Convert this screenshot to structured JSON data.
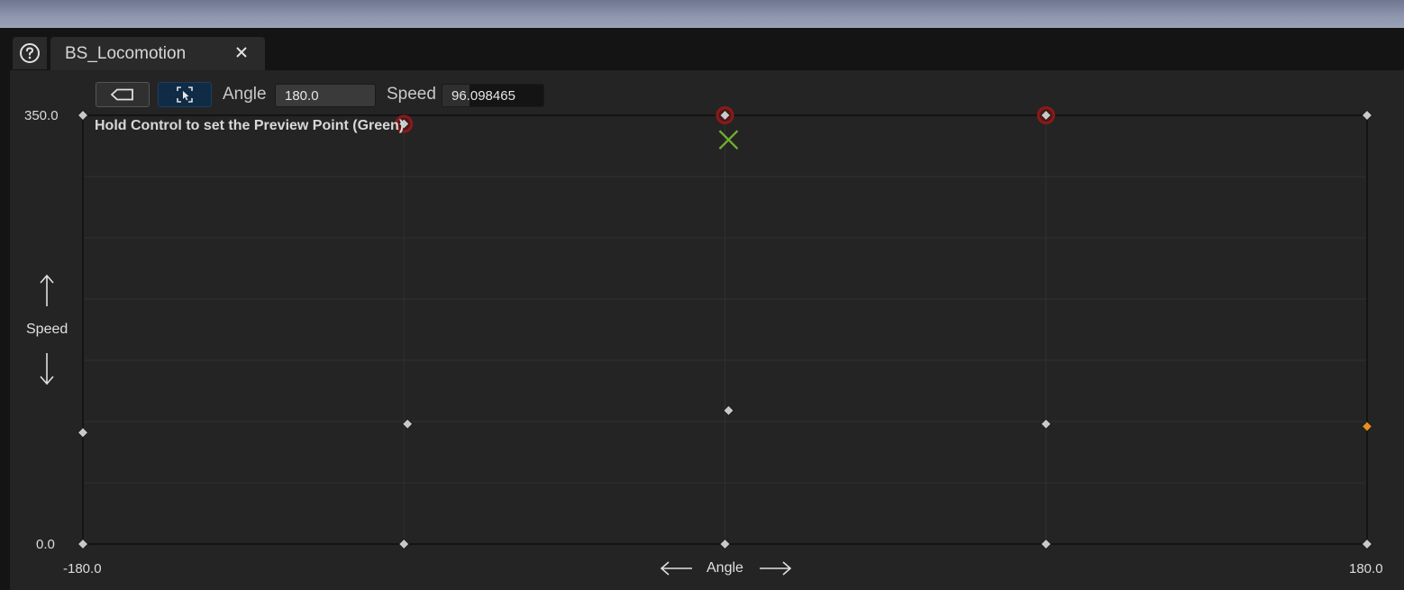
{
  "tab": {
    "title": "BS_Locomotion"
  },
  "toolbar": {
    "angle_label": "Angle",
    "angle_value": "180.0",
    "speed_label": "Speed",
    "speed_value": "96.098465",
    "speed_fill_fraction": 0.27
  },
  "hint": "Hold Control to set the Preview Point (Green)",
  "axes": {
    "y_label": "Speed",
    "y_max_label": "350.0",
    "y_min_label": "0.0",
    "x_label": "Angle",
    "x_min_label": "-180.0",
    "x_max_label": "180.0"
  },
  "chart_data": {
    "type": "scatter",
    "xlabel": "Angle",
    "ylabel": "Speed",
    "xlim": [
      -180,
      180
    ],
    "ylim": [
      0,
      350
    ],
    "grid": true,
    "x_divisions": 4,
    "y_divisions": 7,
    "samples": [
      {
        "x": -180,
        "y": 350,
        "state": "normal"
      },
      {
        "x": -90,
        "y": 343,
        "state": "invalid"
      },
      {
        "x": 0,
        "y": 350,
        "state": "invalid"
      },
      {
        "x": 90,
        "y": 350,
        "state": "invalid"
      },
      {
        "x": 180,
        "y": 350,
        "state": "normal"
      },
      {
        "x": -180,
        "y": 91,
        "state": "normal"
      },
      {
        "x": -89,
        "y": 98,
        "state": "normal"
      },
      {
        "x": 1,
        "y": 109,
        "state": "normal"
      },
      {
        "x": 90,
        "y": 98,
        "state": "normal"
      },
      {
        "x": 180,
        "y": 96,
        "state": "highlighted"
      },
      {
        "x": -180,
        "y": 0,
        "state": "normal"
      },
      {
        "x": -90,
        "y": 0,
        "state": "normal"
      },
      {
        "x": 0,
        "y": 0,
        "state": "normal"
      },
      {
        "x": 90,
        "y": 0,
        "state": "normal"
      },
      {
        "x": 180,
        "y": 0,
        "state": "normal"
      }
    ],
    "preview_point": {
      "x": 1,
      "y": 330
    },
    "colors": {
      "grid": "#303030",
      "border": "#141414",
      "sample": "#c9c9c9",
      "highlight": "#e8901a",
      "invalid_ring": "#8a1a1a",
      "preview": "#6fae2e"
    }
  }
}
